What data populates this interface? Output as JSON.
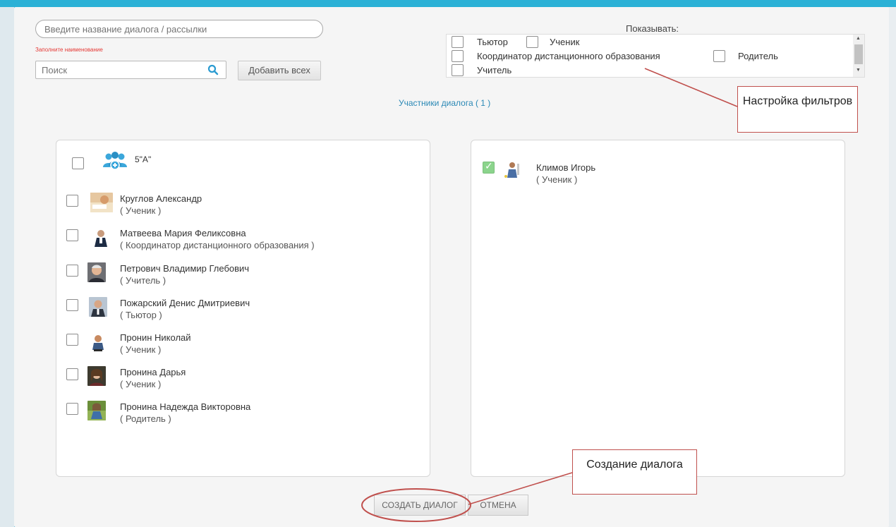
{
  "form": {
    "name_placeholder": "Введите название диалога / рассылки",
    "name_error": "Заполните наименование",
    "search_placeholder": "Поиск",
    "add_all_label": "Добавить всех"
  },
  "filters": {
    "title": "Показывать:",
    "options": [
      {
        "label": "Тьютор",
        "checked": false
      },
      {
        "label": "Ученик",
        "checked": false
      },
      {
        "label": "Координатор дистанционного образования",
        "checked": false
      },
      {
        "label": "Родитель",
        "checked": false
      },
      {
        "label": "Учитель",
        "checked": false
      }
    ]
  },
  "participants_label": "Участники диалога ( 1 )",
  "left_list": {
    "group": {
      "name": "5\"А\"",
      "checked": false
    },
    "users": [
      {
        "name": "Круглов Александр",
        "role": "( Ученик )",
        "checked": false
      },
      {
        "name": "Матвеева Мария Феликсовна",
        "role": "( Координатор дистанционного образования )",
        "checked": false
      },
      {
        "name": "Петрович Владимир Глебович",
        "role": "( Учитель )",
        "checked": false
      },
      {
        "name": "Пожарский Денис Дмитриевич",
        "role": "( Тьютор )",
        "checked": false
      },
      {
        "name": "Пронин Николай",
        "role": "( Ученик )",
        "checked": false
      },
      {
        "name": "Пронина Дарья",
        "role": "( Ученик )",
        "checked": false
      },
      {
        "name": "Пронина Надежда Викторовна",
        "role": "( Родитель )",
        "checked": false
      }
    ]
  },
  "right_list": {
    "users": [
      {
        "name": "Климов Игорь",
        "role": "( Ученик )",
        "checked": true
      }
    ]
  },
  "actions": {
    "create_label": "СОЗДАТЬ ДИАЛОГ",
    "cancel_label": "ОТМЕНА"
  },
  "annotations": {
    "filters_callout": "Настройка фильтров",
    "create_callout": "Создание диалога"
  },
  "colors": {
    "accent": "#2bb1d6",
    "link": "#2a88b5",
    "error": "#e53935",
    "annotation": "#c0504d",
    "checked": "#8bd48c"
  }
}
